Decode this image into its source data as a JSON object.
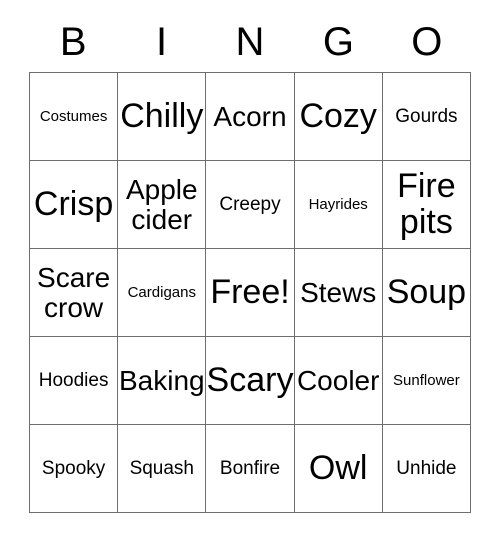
{
  "card": {
    "title": "BINGO",
    "headers": [
      "B",
      "I",
      "N",
      "G",
      "O"
    ],
    "grid_rows": [
      [
        {
          "text": "Costumes",
          "size": "fs-xs"
        },
        {
          "text": "Chilly",
          "size": "fs-xxl"
        },
        {
          "text": "Acorn",
          "size": "fs-lg"
        },
        {
          "text": "Cozy",
          "size": "fs-xxl"
        },
        {
          "text": "Gourds",
          "size": "fs-sm"
        }
      ],
      [
        {
          "text": "Crisp",
          "size": "fs-xxl"
        },
        {
          "text": "Apple\ncider",
          "size": "fs-lg"
        },
        {
          "text": "Creepy",
          "size": "fs-sm"
        },
        {
          "text": "Hayrides",
          "size": "fs-xs"
        },
        {
          "text": "Fire\npits",
          "size": "fs-xxl"
        }
      ],
      [
        {
          "text": "Scare\ncrow",
          "size": "fs-lg"
        },
        {
          "text": "Cardigans",
          "size": "fs-xs"
        },
        {
          "text": "Free!",
          "size": "fs-xxl"
        },
        {
          "text": "Stews",
          "size": "fs-lg"
        },
        {
          "text": "Soup",
          "size": "fs-xxl"
        }
      ],
      [
        {
          "text": "Hoodies",
          "size": "fs-sm"
        },
        {
          "text": "Baking",
          "size": "fs-lg"
        },
        {
          "text": "Scary",
          "size": "fs-xxl"
        },
        {
          "text": "Cooler",
          "size": "fs-lg"
        },
        {
          "text": "Sunflower",
          "size": "fs-xs"
        }
      ],
      [
        {
          "text": "Spooky",
          "size": "fs-sm"
        },
        {
          "text": "Squash",
          "size": "fs-sm"
        },
        {
          "text": "Bonfire",
          "size": "fs-sm"
        },
        {
          "text": "Owl",
          "size": "fs-xxl"
        },
        {
          "text": "Unhide",
          "size": "fs-sm"
        }
      ]
    ],
    "colors": {
      "background": "#ffffff",
      "grid_line": "#6e6e6e",
      "text": "#000000"
    }
  }
}
